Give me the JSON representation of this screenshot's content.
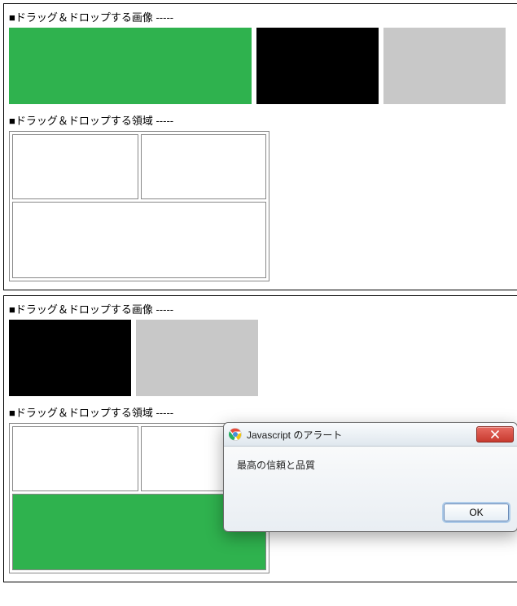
{
  "panel1": {
    "sectionImagesTitle": "■ドラッグ＆ドロップする画像 -----",
    "sectionAreasTitle": "■ドラッグ＆ドロップする領域 -----",
    "swatches": {
      "greenPresent": true,
      "blackPresent": true,
      "greyPresent": true
    }
  },
  "panel2": {
    "sectionImagesTitle": "■ドラッグ＆ドロップする画像 -----",
    "sectionAreasTitle": "■ドラッグ＆ドロップする領域 -----",
    "swatches": {
      "blackPresent": true,
      "greyPresent": true
    },
    "droppedGreenInBottom": true
  },
  "alert": {
    "title": "Javascript のアラート",
    "message": "最高の信頼と品質",
    "okLabel": "OK"
  },
  "colors": {
    "green": "#2fb24e",
    "black": "#000000",
    "grey": "#c8c8c8"
  }
}
